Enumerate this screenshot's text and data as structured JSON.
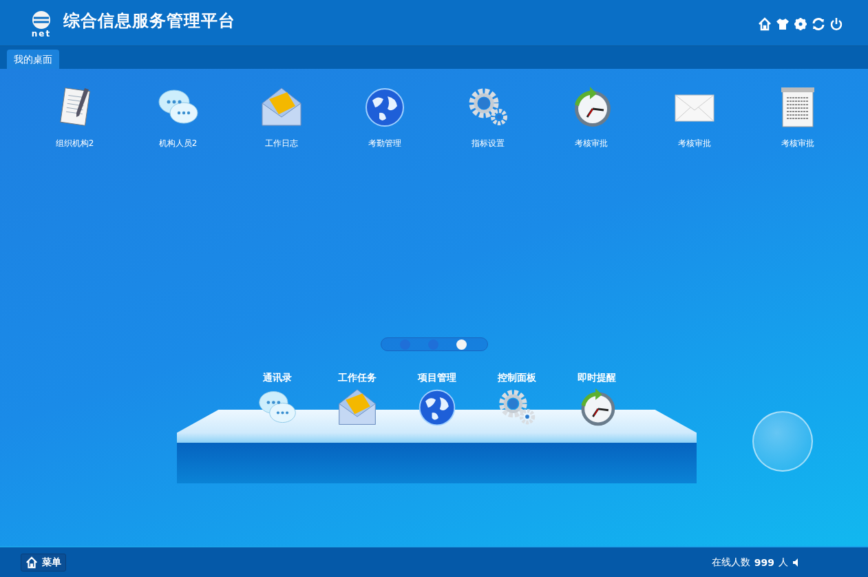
{
  "header": {
    "title": "综合信息服务管理平台",
    "logo_text": "net",
    "tools": [
      {
        "kind": "home"
      },
      {
        "kind": "shirt"
      },
      {
        "kind": "gear"
      },
      {
        "kind": "refresh"
      },
      {
        "kind": "power"
      }
    ]
  },
  "tabs": [
    {
      "label": "我的桌面",
      "selected": true
    }
  ],
  "desktop_icons": [
    {
      "label": "组织机构2",
      "kind": "notepad"
    },
    {
      "label": "机构人员2",
      "kind": "chat"
    },
    {
      "label": "工作日志",
      "kind": "mail"
    },
    {
      "label": "考勤管理",
      "kind": "globe"
    },
    {
      "label": "指标设置",
      "kind": "gears"
    },
    {
      "label": "考核审批",
      "kind": "clock"
    },
    {
      "label": "考核审批",
      "kind": "envelope"
    },
    {
      "label": "考核审批",
      "kind": "document"
    }
  ],
  "pager": [
    {
      "selected": false
    },
    {
      "selected": false
    },
    {
      "selected": true
    }
  ],
  "dock": [
    {
      "label": "通讯录",
      "kind": "chat"
    },
    {
      "label": "工作任务",
      "kind": "mail"
    },
    {
      "label": "项目管理",
      "kind": "globe"
    },
    {
      "label": "控制面板",
      "kind": "gears"
    },
    {
      "label": "即时提醒",
      "kind": "clock"
    }
  ],
  "footer": {
    "menu_label": "菜单",
    "online_label": "在线人数",
    "online_count": "999",
    "online_unit": "人"
  }
}
